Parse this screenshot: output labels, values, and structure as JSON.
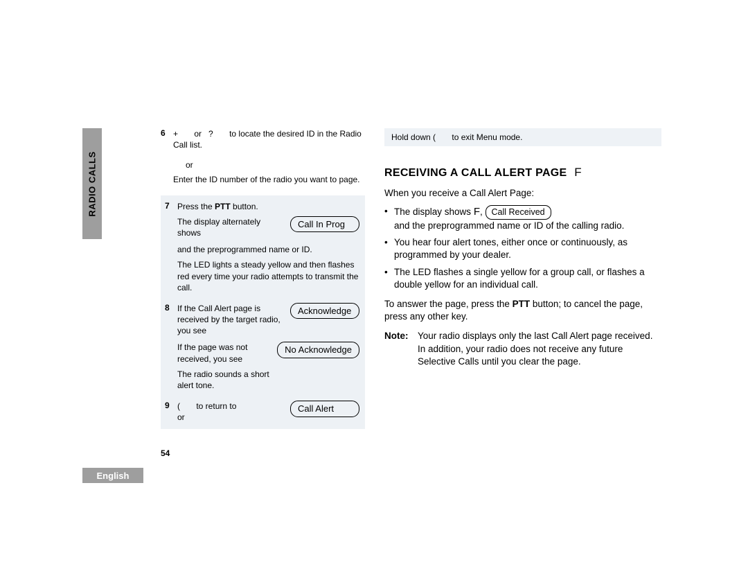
{
  "side_tab": "RADIO CALLS",
  "language": "English",
  "page_number": "54",
  "left": {
    "step6": {
      "num": "6",
      "line1_a": "+",
      "line1_b": "or",
      "line1_c": "?",
      "line1_rest": "to locate the desired ID in the Radio Call list.",
      "or": "or",
      "line2": "Enter the ID number of the radio you want to page."
    },
    "step7": {
      "num": "7",
      "line1_a": "Press the ",
      "line1_bold": "PTT",
      "line1_b": " button.",
      "line2": "The display alternately shows",
      "pill": "Call In Prog",
      "line3": "and the preprogrammed name or ID.",
      "line4": "The LED lights a steady yellow and then flashes red every time your radio attempts to transmit the call."
    },
    "step8": {
      "num": "8",
      "line1": "If the Call Alert page is received by the target radio, you see",
      "pill_ack": "Acknowledge",
      "line2": "If the page was not received, you see",
      "pill_noack": "No Acknowledge",
      "line3": "The radio sounds a short alert tone."
    },
    "step9": {
      "num": "9",
      "line1_a": "(",
      "line1_b": "to return to",
      "or": "or",
      "pill": "Call Alert"
    }
  },
  "right": {
    "hint_a": "Hold down ",
    "hint_b": "(",
    "hint_c": " to exit Menu mode.",
    "heading": "RECEIVING A CALL ALERT PAGE",
    "heading_icon": "F",
    "intro": "When you receive a Call Alert Page:",
    "bullet1_a": "The display shows ",
    "bullet1_icon": "F",
    "bullet1_sep": ", ",
    "bullet1_pill": "Call Received",
    "bullet1_b": "and the preprogrammed name or ID of the calling radio.",
    "bullet2": "You hear four alert tones, either once or continuously, as programmed by your dealer.",
    "bullet3": "The LED flashes a single yellow for a group call, or flashes a double yellow for an individual call.",
    "answer_a": "To answer the page, press the ",
    "answer_bold": "PTT",
    "answer_b": " button; to cancel the page, press any other key.",
    "note_label": "Note:",
    "note_body": "Your radio displays only the last Call Alert page received. In addition, your radio does not receive any future Selective Calls until you clear the page."
  }
}
